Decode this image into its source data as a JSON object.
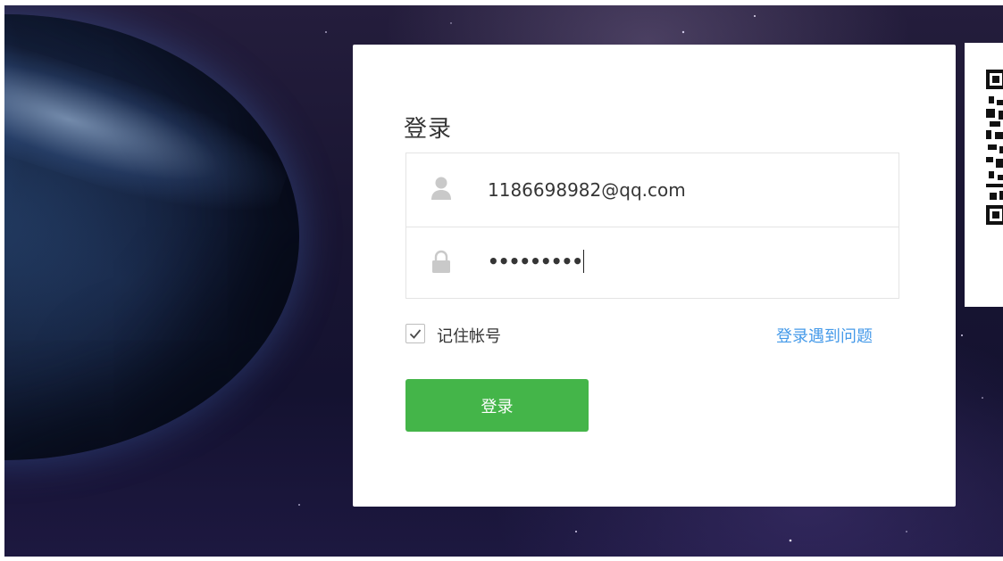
{
  "login": {
    "title": "登录",
    "account": "1186698982@qq.com",
    "password_masked": "•••••••••",
    "remember_label": "记住帐号",
    "remember_checked": true,
    "help_link": "登录遇到问题",
    "submit_label": "登录"
  },
  "icons": {
    "account": "user-icon",
    "password": "lock-icon",
    "remember": "checkmark-icon",
    "qr": "qr-code-icon"
  },
  "colors": {
    "primary_button": "#44b549",
    "link": "#459ae9",
    "text": "#353535"
  }
}
